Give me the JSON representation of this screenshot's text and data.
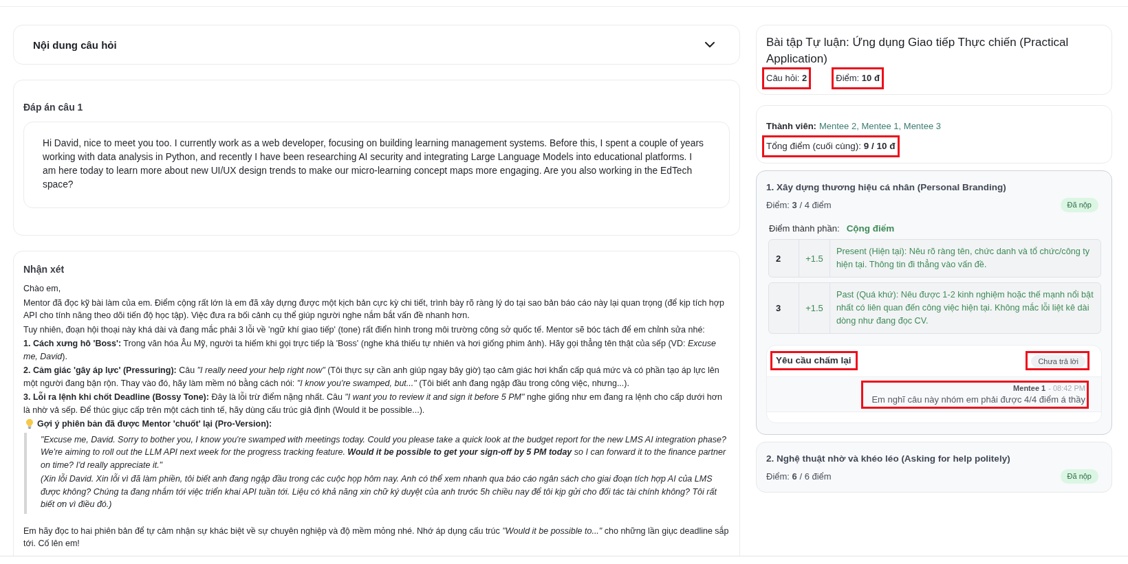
{
  "question_section": {
    "title": "Nội dung câu hỏi",
    "expanded": false
  },
  "answer_section": {
    "title": "Đáp án câu 1",
    "text": "Hi David, nice to meet you too. I currently work as a web developer, focusing on building learning management systems. Before this, I spent a couple of years working with data analysis in Python, and recently I have been researching AI security and integrating Large Language Models into educational platforms. I am here today to learn more about new UI/UX design trends to make our micro-learning concept maps more engaging. Are you also working in the EdTech space?"
  },
  "feedback_section": {
    "title": "Nhận xét",
    "paragraphs": [
      "Chào em,",
      "Mentor đã đọc kỹ bài làm của em. Điểm cộng rất lớn là em đã xây dựng được một kịch bản cực kỳ chi tiết, trình bày rõ ràng lý do tại sao bản báo cáo này lại quan trọng (để kịp tích hợp API cho tính năng theo dõi tiến độ học tập). Việc đưa ra bối cảnh cụ thể giúp người nghe nắm bắt vấn đề nhanh hơn.",
      "Tuy nhiên, đoạn hội thoại này khá dài và đang mắc phải 3 lỗi về 'ngữ khí giao tiếp' (tone) rất điển hình trong môi trường công sở quốc tế. Mentor sẽ bóc tách để em chỉnh sửa nhé:",
      "**1. Cách xưng hô 'Boss':** Trong văn hóa Âu Mỹ, người ta hiếm khi gọi trực tiếp là 'Boss' (nghe khá thiếu tự nhiên và hơi giống phim ảnh). Hãy gọi thẳng tên thật của sếp (VD: *Excuse me, David*).",
      "**2. Cảm giác 'gây áp lực' (Pressuring):** Câu *\"I really need your help right now\"* (Tôi thực sự cần anh giúp ngay bây giờ) tạo cảm giác hơi khẩn cấp quá mức và có phần tạo áp lực lên một người đang bận rộn. Thay vào đó, hãy làm mềm nó bằng cách nói: *\"I know you're swamped, but...\"* (Tôi biết anh đang ngập đầu trong công việc, nhưng...).",
      "**3. Lỗi ra lệnh khi chốt Deadline (Bossy Tone):** Đây là lỗi trừ điểm nặng nhất. Câu *\"I want you to review it and sign it before 5 PM\"* nghe giống như em đang ra lệnh cho cấp dưới hơn là nhờ vả sếp. Để thúc giục cấp trên một cách tinh tế, hãy dùng cấu trúc giả định (Would it be possible...)."
    ],
    "tip": {
      "heading": "Gợi ý phiên bản đã được Mentor 'chuốt' lại (Pro-Version):",
      "quotes": [
        "\"Excuse me, David. Sorry to bother you, I know you're swamped with meetings today. Could you please take a quick look at the budget report for the new LMS AI integration phase? We're aiming to roll out the LLM API next week for the progress tracking feature. **Would it be possible to get your sign-off by 5 PM today** so I can forward it to the finance partner on time? I'd really appreciate it.\"",
        "(Xin lỗi David. Xin lỗi vì đã làm phiền, tôi biết anh đang ngập đầu trong các cuộc họp hôm nay. Anh có thể xem nhanh qua báo cáo ngân sách cho giai đoạn tích hợp AI của LMS được không? Chúng ta đang nhắm tới việc triển khai API tuần tới. Liệu có khả năng xin chữ ký duyệt của anh trước 5h chiều nay để tôi kịp gửi cho đối tác tài chính không? Tôi rất biết ơn vì điều đó.)"
      ]
    },
    "closing": "Em hãy đọc to hai phiên bản để tự cảm nhận sự khác biệt về sự chuyên nghiệp và độ mềm mỏng nhé. Nhớ áp dụng cấu trúc *\"Would it be possible to...\"* cho những lần giục deadline sắp tới. Cố lên em!"
  },
  "assignment": {
    "title": "Bài tập Tự luận: Ứng dụng Giao tiếp Thực chiến (Practical Application)",
    "stats": [
      {
        "text": "Câu hỏi: **2**",
        "highlighted": true
      },
      {
        "text": "Điểm: **10 đ**",
        "highlighted": true
      }
    ]
  },
  "group": {
    "members_label": "Thành viên:",
    "members": "Mentee 2, Mentee 1, Mentee 3",
    "total": {
      "text": "Tổng điểm (cuối cùng): **9 / 10 đ**",
      "highlighted": true
    }
  },
  "questions": [
    {
      "title": "1. Xây dựng thương hiệu cá nhân (Personal Branding)",
      "score": "Điểm: **3** / 4 điểm",
      "status": "Đã nộp",
      "expanded": true,
      "components": {
        "label": "Điểm thành phần:",
        "mode": "Cộng điểm",
        "rows": [
          {
            "criterion": "2",
            "points": "+1.5",
            "description": "Present (Hiện tại): Nêu rõ ràng tên, chức danh và tổ chức/công ty hiện tại. Thông tin đi thẳng vào vấn đề."
          },
          {
            "criterion": "3",
            "points": "+1.5",
            "description": "Past (Quá khứ): Nêu được 1-2 kinh nghiệm hoặc thế mạnh nổi bật nhất có liên quan đến công việc hiện tại. Không mắc lỗi liệt kê dài dòng như đang đọc CV."
          }
        ]
      },
      "regrade": {
        "title": "Yêu cầu chấm lại",
        "title_highlighted": true,
        "status": "Chưa trả lời",
        "status_highlighted": true,
        "messages": [
          {
            "author": "Mentee 1",
            "time": "- 08:42 PM",
            "text": "Em nghĩ câu này nhóm em phải được 4/4 điểm á thầy",
            "highlighted": true
          }
        ]
      }
    },
    {
      "title": "2. Nghệ thuật nhờ và khéo léo (Asking for help politely)",
      "score": "Điểm: **6** / 6 điểm",
      "status": "Đã nộp",
      "expanded": false
    }
  ]
}
